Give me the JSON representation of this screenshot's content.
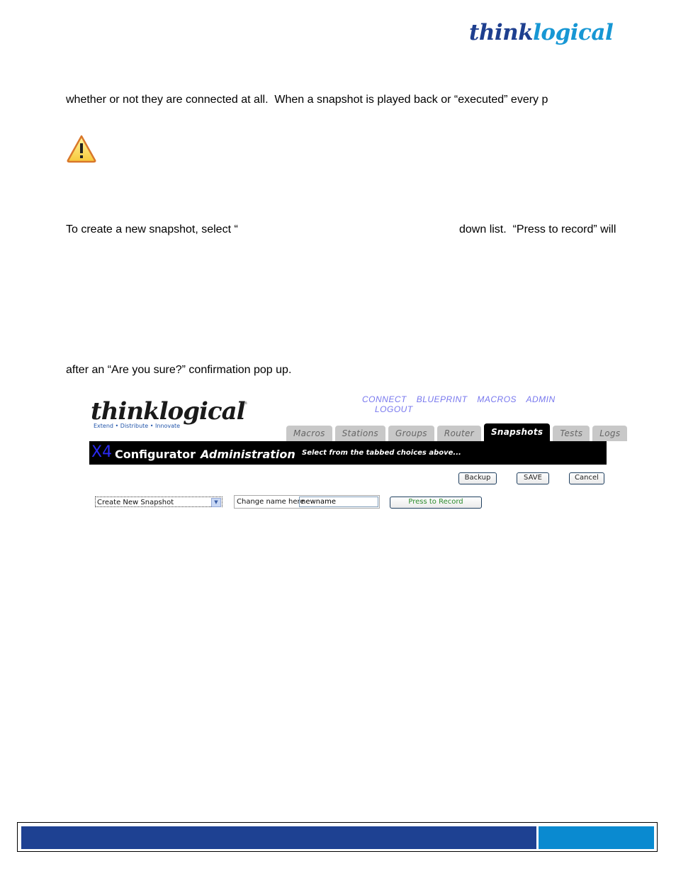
{
  "header": {
    "brand_part1": "think",
    "brand_part2": "logical"
  },
  "body": {
    "para1": "whether or not they are connected at all.  When a snapshot is played back or “executed” every p",
    "para2_start": "To create a new snapshot, select “",
    "para2_end": "down list.  “Press to record” will",
    "para3": "after an “Are you sure?” confirmation pop up.",
    "warning_icon": "warning-triangle-icon"
  },
  "app": {
    "logo_word": "thinklogical",
    "logo_tm": "tm",
    "logo_tagline": "Extend • Distribute • Innovate",
    "topnav": [
      "CONNECT",
      "BLUEPRINT",
      "MACROS",
      "ADMIN",
      "LOGOUT"
    ],
    "tabs": [
      {
        "label": "Macros",
        "active": false
      },
      {
        "label": "Stations",
        "active": false
      },
      {
        "label": "Groups",
        "active": false
      },
      {
        "label": "Router",
        "active": false
      },
      {
        "label": "Snapshots",
        "active": true
      },
      {
        "label": "Tests",
        "active": false
      },
      {
        "label": "Logs",
        "active": false
      }
    ],
    "banner": {
      "x4": "X4",
      "configurator": "Configurator",
      "section": "Administration",
      "hint": "Select from the tabbed choices above..."
    },
    "buttons": {
      "backup": "Backup",
      "save": "SAVE",
      "cancel": "Cancel",
      "record": "Press to Record"
    },
    "snapshot_select": {
      "selected": "Create New Snapshot"
    },
    "name_field": {
      "label": "Change name here",
      "value": "newname"
    }
  },
  "colors": {
    "brand_dark": "#1e3f8f",
    "brand_light": "#1797d4",
    "footer_dark": "#1e4192",
    "footer_light": "#0a8ad0",
    "nav_link": "#7777ee",
    "record_text": "#2a8a2a"
  }
}
